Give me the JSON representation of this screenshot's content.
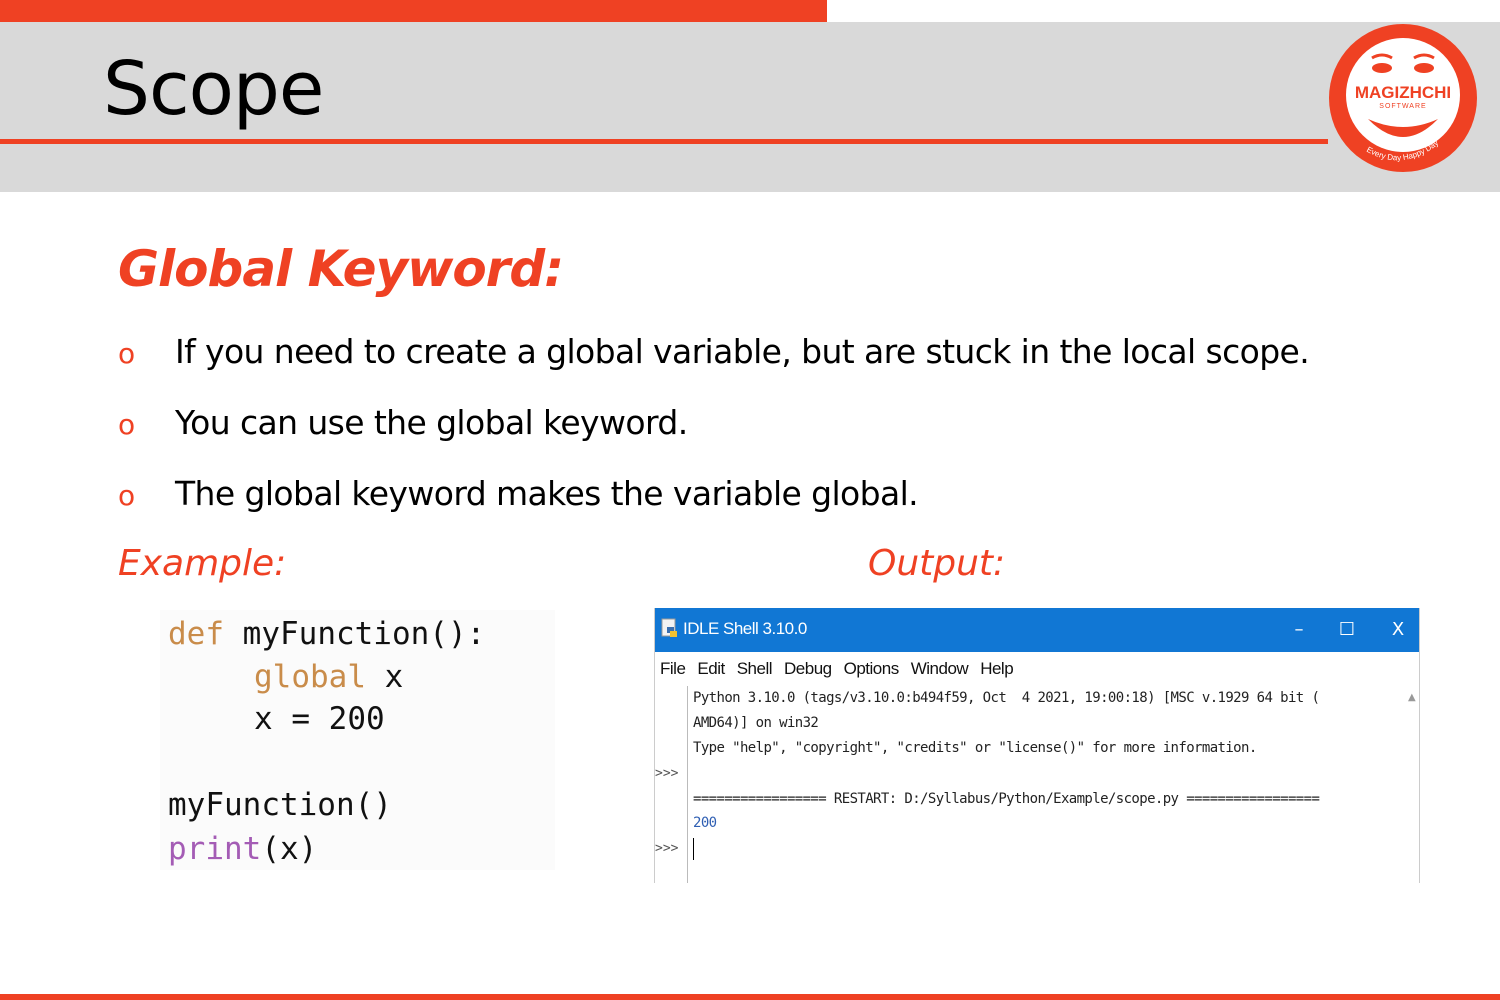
{
  "slide": {
    "title": "Scope",
    "heading": "Global Keyword:",
    "bullets": [
      "If you need to create a global variable, but are stuck in the local scope.",
      "You can use the global keyword.",
      "The global keyword makes the variable global."
    ],
    "bullet_marker": "o",
    "example_label": "Example:",
    "output_label": "Output:"
  },
  "logo": {
    "brand": "MAGIZHCHI",
    "sub": "SOFTWARE",
    "tagline": "Every Day Happy Day"
  },
  "code": {
    "line1": {
      "kw": "def",
      "rest": " myFunction():"
    },
    "line2": {
      "kw": "global",
      "rest": " x"
    },
    "line3": "x = 200",
    "line4": "myFunction()",
    "line5": {
      "bi": "print",
      "rest": "(x)"
    }
  },
  "idle": {
    "title": "IDLE Shell 3.10.0",
    "minimize": "–",
    "maximize": "☐",
    "close": "X",
    "menu": [
      "File",
      "Edit",
      "Shell",
      "Debug",
      "Options",
      "Window",
      "Help"
    ],
    "prompt": ">>>",
    "lines": [
      "Python 3.10.0 (tags/v3.10.0:b494f59, Oct  4 2021, 19:00:18) [MSC v.1929 64 bit (",
      "AMD64)] on win32",
      "Type \"help\", \"copyright\", \"credits\" or \"license()\" for more information.",
      "================= RESTART: D:/Syllabus/Python/Example/scope.py ================="
    ],
    "result": "200"
  },
  "colors": {
    "accent": "#EF4123",
    "header_band": "#D9D9D9",
    "idle_titlebar": "#1177D4"
  }
}
